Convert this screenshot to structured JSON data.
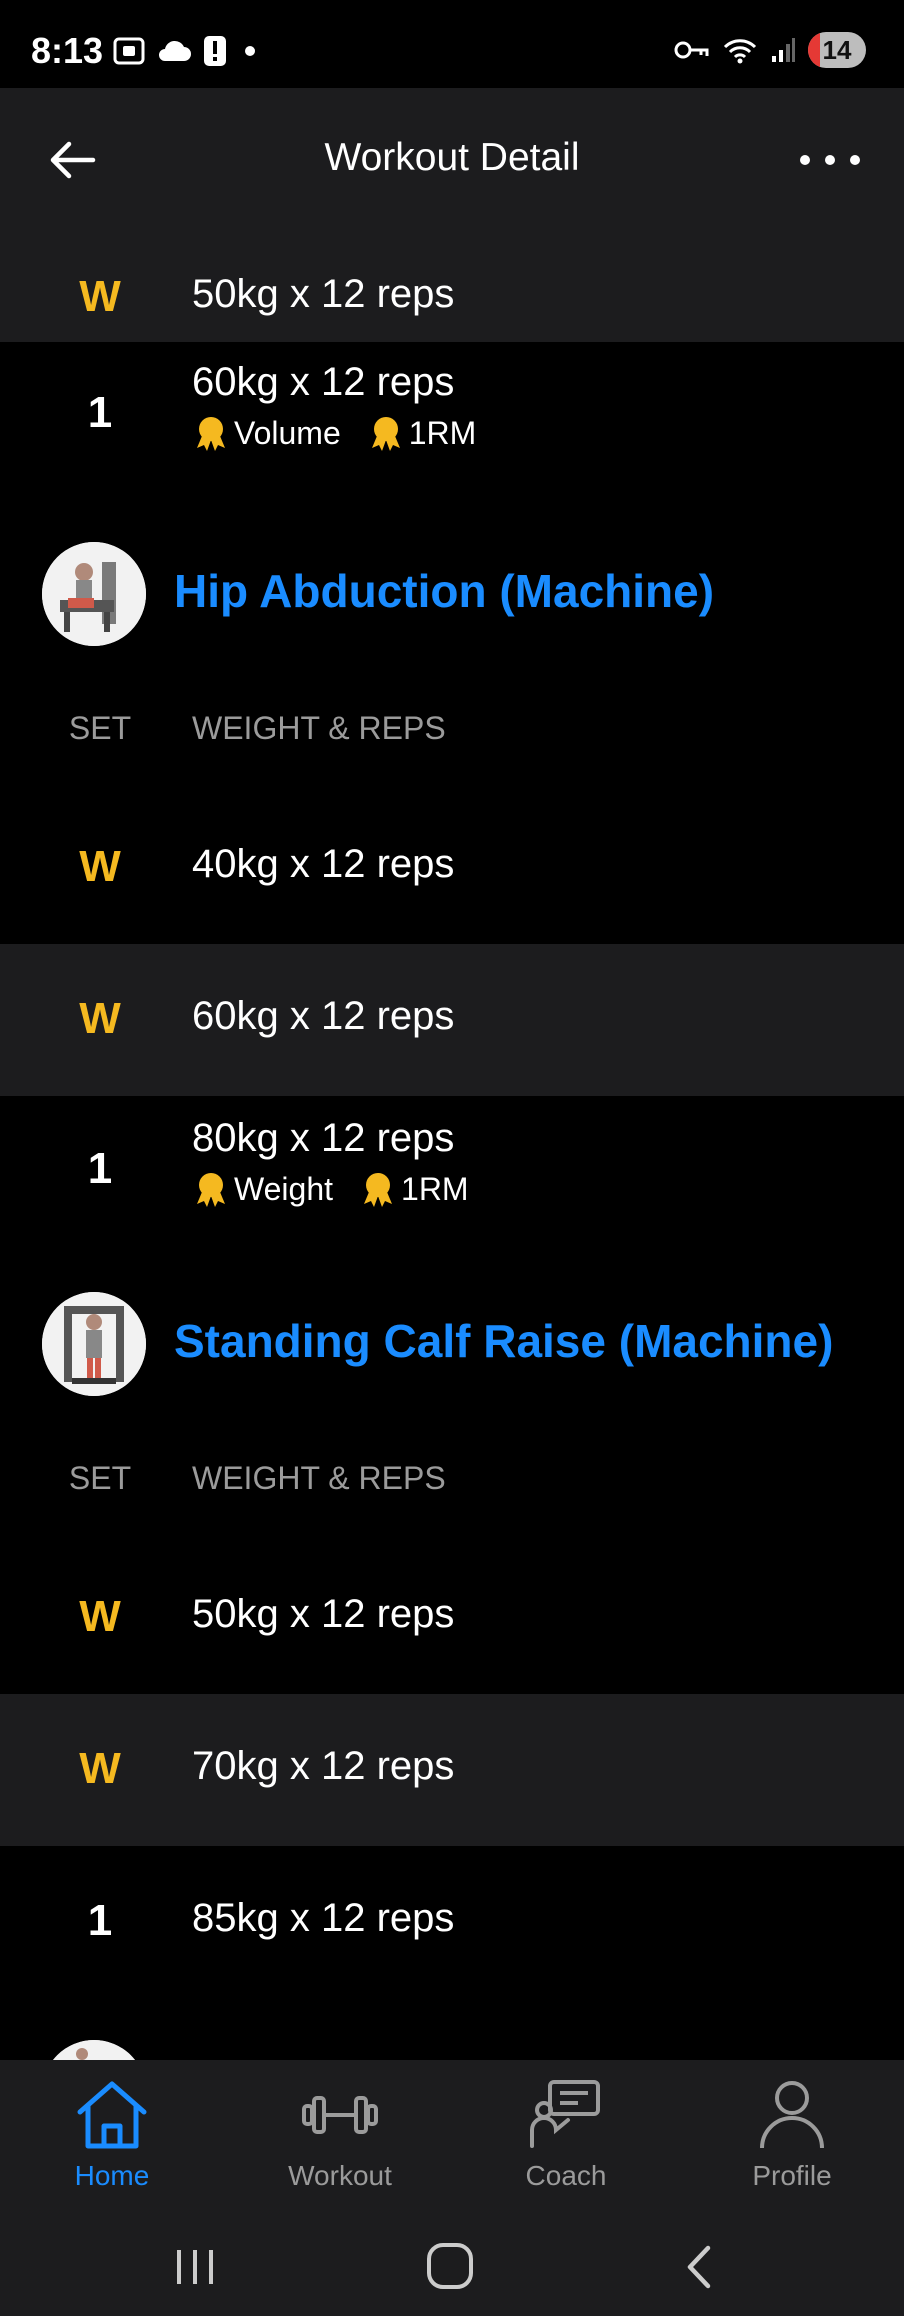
{
  "status_bar": {
    "time": "8:13",
    "battery_level": "14"
  },
  "header": {
    "title": "Workout Detail"
  },
  "colors": {
    "accent": "#1a8cff",
    "warmup": "#f5b920",
    "background": "#000000",
    "surface": "#1c1c1e",
    "muted_text": "#9b9b9b"
  },
  "top_sets": [
    {
      "set": "W",
      "type": "warmup",
      "value": "50kg x 12 reps",
      "badges": []
    },
    {
      "set": "1",
      "type": "working",
      "value": "60kg x 12 reps",
      "badges": [
        "Volume",
        "1RM"
      ]
    }
  ],
  "exercises": [
    {
      "name": "Hip Abduction (Machine)",
      "col_set": "SET",
      "col_weight_reps": "WEIGHT & REPS",
      "sets": [
        {
          "set": "W",
          "type": "warmup",
          "value": "40kg x 12 reps",
          "badges": []
        },
        {
          "set": "W",
          "type": "warmup",
          "value": "60kg x 12 reps",
          "badges": []
        },
        {
          "set": "1",
          "type": "working",
          "value": "80kg x 12 reps",
          "badges": [
            "Weight",
            "1RM"
          ]
        }
      ]
    },
    {
      "name": "Standing Calf Raise (Machine)",
      "col_set": "SET",
      "col_weight_reps": "WEIGHT & REPS",
      "sets": [
        {
          "set": "W",
          "type": "warmup",
          "value": "50kg x 12 reps",
          "badges": []
        },
        {
          "set": "W",
          "type": "warmup",
          "value": "70kg x 12 reps",
          "badges": []
        },
        {
          "set": "1",
          "type": "working",
          "value": "85kg x 12 reps",
          "badges": []
        }
      ]
    }
  ],
  "bottom_nav": {
    "items": [
      {
        "label": "Home",
        "icon": "home-icon",
        "active": true
      },
      {
        "label": "Workout",
        "icon": "dumbbell-icon",
        "active": false
      },
      {
        "label": "Coach",
        "icon": "coach-icon",
        "active": false
      },
      {
        "label": "Profile",
        "icon": "profile-icon",
        "active": false
      }
    ]
  },
  "system_nav": {
    "buttons": [
      "recent-apps-icon",
      "home-circle-icon",
      "back-chevron-icon"
    ]
  }
}
